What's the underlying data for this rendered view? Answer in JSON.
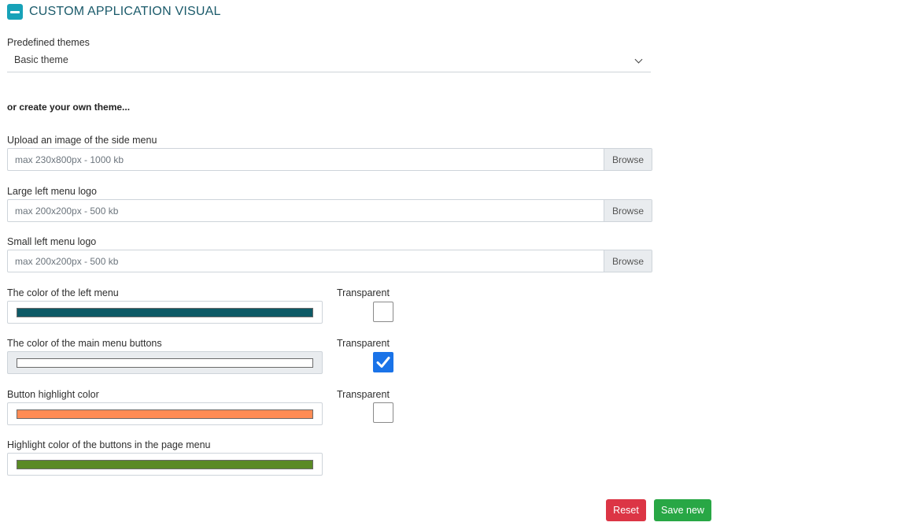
{
  "section": {
    "title": "CUSTOM APPLICATION VISUAL"
  },
  "themes": {
    "label": "Predefined themes",
    "selected": "Basic theme"
  },
  "own_theme_text": "or create your own theme...",
  "uploads": [
    {
      "label": "Upload an image of the side menu",
      "placeholder": "max 230x800px - 1000 kb",
      "button": "Browse"
    },
    {
      "label": "Large left menu logo",
      "placeholder": "max 200x200px - 500 kb",
      "button": "Browse"
    },
    {
      "label": "Small left menu logo",
      "placeholder": "max 200x200px - 500 kb",
      "button": "Browse"
    }
  ],
  "colors": [
    {
      "label": "The color of the left menu",
      "value": "#0d5a66",
      "transparent_label": "Transparent",
      "transparent": false
    },
    {
      "label": "The color of the main menu buttons",
      "value": "#ffffff",
      "transparent_label": "Transparent",
      "transparent": true
    },
    {
      "label": "Button highlight color",
      "value": "#ff8c55",
      "transparent_label": "Transparent",
      "transparent": false
    },
    {
      "label": "Highlight color of the buttons in the page menu",
      "value": "#5a8a25"
    }
  ],
  "actions": {
    "reset": "Reset",
    "save": "Save new"
  }
}
